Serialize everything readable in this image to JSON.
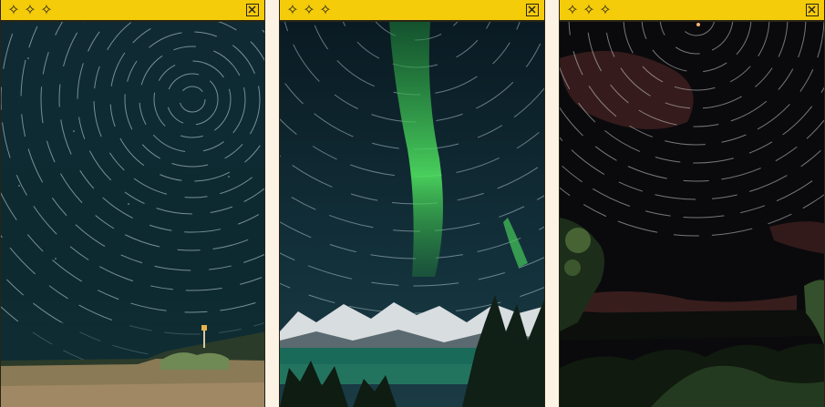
{
  "windows": [
    {
      "id": "window-1",
      "title_icons": [
        "sparkle-icon",
        "sparkle-icon",
        "sparkle-icon"
      ],
      "close_icon": "close-icon",
      "photo": "star-trails-over-grassy-beach"
    },
    {
      "id": "window-2",
      "title_icons": [
        "sparkle-icon",
        "sparkle-icon",
        "sparkle-icon"
      ],
      "close_icon": "close-icon",
      "photo": "aurora-over-snowy-mountains-and-lake"
    },
    {
      "id": "window-3",
      "title_icons": [
        "sparkle-icon",
        "sparkle-icon",
        "sparkle-icon"
      ],
      "close_icon": "close-icon",
      "photo": "star-trails-over-trees-red-clouds"
    }
  ],
  "colors": {
    "titlebar": "#f5cc0a",
    "border": "#2a2416",
    "page_background": "#fdf3e4"
  },
  "glyphs": {
    "sparkle": "✧"
  }
}
